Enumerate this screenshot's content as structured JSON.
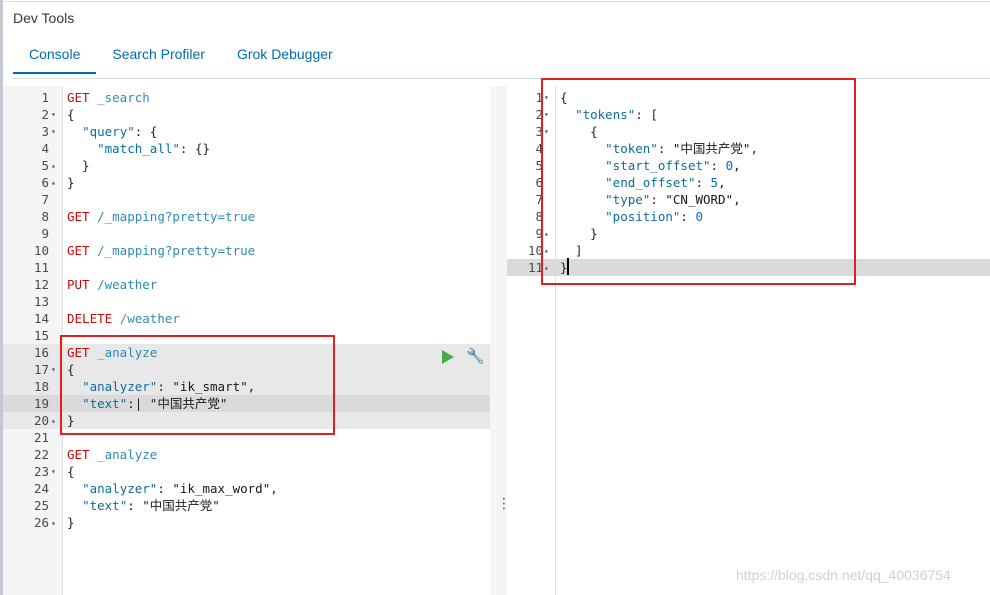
{
  "app": {
    "title": "Dev Tools"
  },
  "tabs": [
    {
      "label": "Console"
    },
    {
      "label": "Search Profiler"
    },
    {
      "label": "Grok Debugger"
    }
  ],
  "request_editor": {
    "lines": [
      {
        "num": "1",
        "fold": "",
        "parts": [
          [
            "m",
            "GET"
          ],
          [
            "p",
            " "
          ],
          [
            "u",
            "_search"
          ]
        ]
      },
      {
        "num": "2",
        "fold": "▾",
        "parts": [
          [
            "p",
            "{"
          ]
        ]
      },
      {
        "num": "3",
        "fold": "▾",
        "parts": [
          [
            "p",
            "  "
          ],
          [
            "k",
            "\"query\""
          ],
          [
            "p",
            ": {"
          ]
        ]
      },
      {
        "num": "4",
        "fold": "",
        "parts": [
          [
            "p",
            "    "
          ],
          [
            "k",
            "\"match_all\""
          ],
          [
            "p",
            ": {}"
          ]
        ]
      },
      {
        "num": "5",
        "fold": "▴",
        "parts": [
          [
            "p",
            "  }"
          ]
        ]
      },
      {
        "num": "6",
        "fold": "▴",
        "parts": [
          [
            "p",
            "}"
          ]
        ]
      },
      {
        "num": "7",
        "fold": "",
        "parts": []
      },
      {
        "num": "8",
        "fold": "",
        "parts": [
          [
            "m",
            "GET"
          ],
          [
            "p",
            " "
          ],
          [
            "u",
            "/_mapping?pretty=true"
          ]
        ]
      },
      {
        "num": "9",
        "fold": "",
        "parts": []
      },
      {
        "num": "10",
        "fold": "",
        "parts": [
          [
            "m",
            "GET"
          ],
          [
            "p",
            " "
          ],
          [
            "u",
            "/_mapping?pretty=true"
          ]
        ]
      },
      {
        "num": "11",
        "fold": "",
        "parts": []
      },
      {
        "num": "12",
        "fold": "",
        "parts": [
          [
            "m",
            "PUT"
          ],
          [
            "p",
            " "
          ],
          [
            "u",
            "/weather"
          ]
        ]
      },
      {
        "num": "13",
        "fold": "",
        "parts": []
      },
      {
        "num": "14",
        "fold": "",
        "parts": [
          [
            "m",
            "DELETE"
          ],
          [
            "p",
            " "
          ],
          [
            "u",
            "/weather"
          ]
        ]
      },
      {
        "num": "15",
        "fold": "",
        "parts": []
      },
      {
        "num": "16",
        "fold": "",
        "parts": [
          [
            "m",
            "GET"
          ],
          [
            "p",
            " "
          ],
          [
            "u",
            "_analyze"
          ]
        ]
      },
      {
        "num": "17",
        "fold": "▾",
        "parts": [
          [
            "p",
            "{"
          ]
        ]
      },
      {
        "num": "18",
        "fold": "",
        "parts": [
          [
            "p",
            "  "
          ],
          [
            "k",
            "\"analyzer\""
          ],
          [
            "p",
            ": "
          ],
          [
            "s",
            "\"ik_smart\""
          ],
          [
            "p",
            ","
          ]
        ]
      },
      {
        "num": "19",
        "fold": "",
        "parts": [
          [
            "p",
            "  "
          ],
          [
            "k",
            "\"text\""
          ],
          [
            "p",
            ":| "
          ],
          [
            "s",
            "\"中国共产党\""
          ]
        ]
      },
      {
        "num": "20",
        "fold": "▴",
        "parts": [
          [
            "p",
            "}"
          ]
        ]
      },
      {
        "num": "21",
        "fold": "",
        "parts": []
      },
      {
        "num": "22",
        "fold": "",
        "parts": [
          [
            "m",
            "GET"
          ],
          [
            "p",
            " "
          ],
          [
            "u",
            "_analyze"
          ]
        ]
      },
      {
        "num": "23",
        "fold": "▾",
        "parts": [
          [
            "p",
            "{"
          ]
        ]
      },
      {
        "num": "24",
        "fold": "",
        "parts": [
          [
            "p",
            "  "
          ],
          [
            "k",
            "\"analyzer\""
          ],
          [
            "p",
            ": "
          ],
          [
            "s",
            "\"ik_max_word\""
          ],
          [
            "p",
            ","
          ]
        ]
      },
      {
        "num": "25",
        "fold": "",
        "parts": [
          [
            "p",
            "  "
          ],
          [
            "k",
            "\"text\""
          ],
          [
            "p",
            ": "
          ],
          [
            "s",
            "\"中国共产党\""
          ]
        ]
      },
      {
        "num": "26",
        "fold": "▴",
        "parts": [
          [
            "p",
            "}"
          ]
        ]
      }
    ]
  },
  "response_editor": {
    "lines": [
      {
        "num": "1",
        "fold": "▾",
        "parts": [
          [
            "p",
            "{"
          ]
        ]
      },
      {
        "num": "2",
        "fold": "▾",
        "parts": [
          [
            "p",
            "  "
          ],
          [
            "k",
            "\"tokens\""
          ],
          [
            "p",
            ": ["
          ]
        ]
      },
      {
        "num": "3",
        "fold": "▾",
        "parts": [
          [
            "p",
            "    {"
          ]
        ]
      },
      {
        "num": "4",
        "fold": "",
        "parts": [
          [
            "p",
            "      "
          ],
          [
            "k",
            "\"token\""
          ],
          [
            "p",
            ": "
          ],
          [
            "s",
            "\"中国共产党\""
          ],
          [
            "p",
            ","
          ]
        ]
      },
      {
        "num": "5",
        "fold": "",
        "parts": [
          [
            "p",
            "      "
          ],
          [
            "k",
            "\"start_offset\""
          ],
          [
            "p",
            ": "
          ],
          [
            "n",
            "0"
          ],
          [
            "p",
            ","
          ]
        ]
      },
      {
        "num": "6",
        "fold": "",
        "parts": [
          [
            "p",
            "      "
          ],
          [
            "k",
            "\"end_offset\""
          ],
          [
            "p",
            ": "
          ],
          [
            "n",
            "5"
          ],
          [
            "p",
            ","
          ]
        ]
      },
      {
        "num": "7",
        "fold": "",
        "parts": [
          [
            "p",
            "      "
          ],
          [
            "k",
            "\"type\""
          ],
          [
            "p",
            ": "
          ],
          [
            "s",
            "\"CN_WORD\""
          ],
          [
            "p",
            ","
          ]
        ]
      },
      {
        "num": "8",
        "fold": "",
        "parts": [
          [
            "p",
            "      "
          ],
          [
            "k",
            "\"position\""
          ],
          [
            "p",
            ": "
          ],
          [
            "n",
            "0"
          ]
        ]
      },
      {
        "num": "9",
        "fold": "▴",
        "parts": [
          [
            "p",
            "    }"
          ]
        ]
      },
      {
        "num": "10",
        "fold": "▴",
        "parts": [
          [
            "p",
            "  ]"
          ]
        ]
      },
      {
        "num": "11",
        "fold": "▴",
        "parts": [
          [
            "p",
            "}"
          ]
        ]
      }
    ]
  },
  "watermark": "https://blog.csdn.net/qq_40036754",
  "colors": {
    "accent": "#006bb4",
    "method": "#c80a0a",
    "url": "#2f8bb4",
    "highlight_box": "#e02020",
    "run": "#4ca84f"
  }
}
